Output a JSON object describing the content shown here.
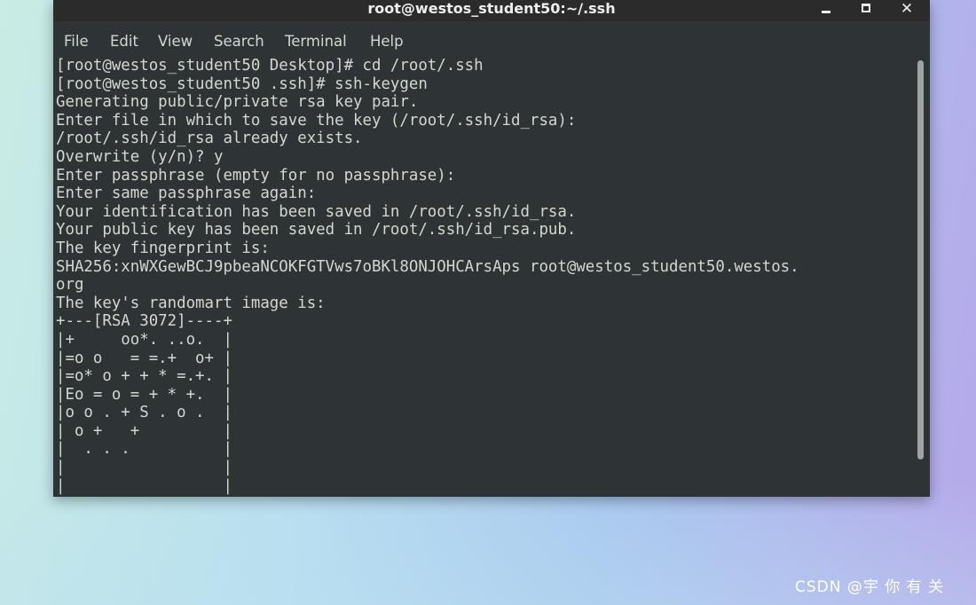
{
  "window": {
    "title": "root@westos_student50:~/.ssh",
    "controls": {
      "minimize_icon": "minimize-icon",
      "maximize_icon": "maximize-icon",
      "close_label": "✕"
    }
  },
  "menubar": {
    "items": [
      "File",
      "Edit",
      "View",
      "Search",
      "Terminal",
      "Help"
    ]
  },
  "terminal": {
    "lines": [
      "[root@westos_student50 Desktop]# cd /root/.ssh",
      "[root@westos_student50 .ssh]# ssh-keygen",
      "Generating public/private rsa key pair.",
      "Enter file in which to save the key (/root/.ssh/id_rsa):",
      "/root/.ssh/id_rsa already exists.",
      "Overwrite (y/n)? y",
      "Enter passphrase (empty for no passphrase):",
      "Enter same passphrase again:",
      "Your identification has been saved in /root/.ssh/id_rsa.",
      "Your public key has been saved in /root/.ssh/id_rsa.pub.",
      "The key fingerprint is:",
      "SHA256:xnWXGewBCJ9pbeaNCOKFGTVws7oBKl8ONJOHCArsAps root@westos_student50.westos.",
      "org",
      "The key's randomart image is:",
      "+---[RSA 3072]----+",
      "|+     oo*. ..o.  |",
      "|=o o   = =.+  o+ |",
      "|=o* o + + * =.+. |",
      "|Eo = o = + * +.  |",
      "|o o . + S . o .  |",
      "| o +   +         |",
      "|  . . .          |",
      "|                 |",
      "|                 |"
    ],
    "colors": {
      "background": "#2e3436",
      "foreground": "#d3d7cf"
    }
  },
  "watermark": "CSDN @宇 你 有 关"
}
